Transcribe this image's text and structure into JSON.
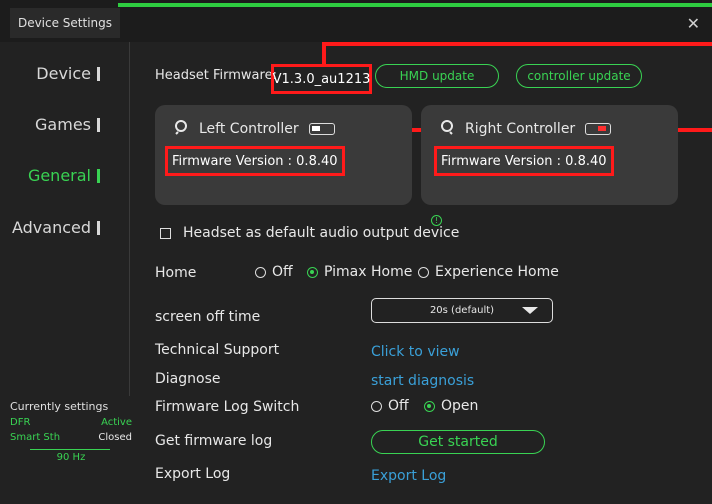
{
  "window": {
    "title": "Device Settings",
    "close_glyph": "✕"
  },
  "nav": {
    "items": [
      {
        "label": "Device",
        "active": false
      },
      {
        "label": "Games",
        "active": false
      },
      {
        "label": "General",
        "active": true
      },
      {
        "label": "Advanced",
        "active": false
      }
    ]
  },
  "current_settings": {
    "title": "Currently settings",
    "rows": [
      {
        "key": "DFR",
        "value": "Active"
      },
      {
        "key": "Smart Sth",
        "value": "Closed"
      }
    ],
    "refresh_rate": "90 Hz"
  },
  "headset": {
    "firmware_label": "Headset Firmware:",
    "firmware_value": "V1.3.0_au1213",
    "hmd_update_label": "HMD update",
    "controller_update_label": "controller update"
  },
  "controllers": {
    "left": {
      "name": "Left Controller",
      "firmware": "Firmware Version : 0.8.40"
    },
    "right": {
      "name": "Right Controller",
      "firmware": "Firmware Version : 0.8.40"
    }
  },
  "audio": {
    "label": "Headset as default audio output device",
    "checked": false
  },
  "home": {
    "label": "Home",
    "options": [
      "Off",
      "Pimax Home",
      "Experience Home"
    ],
    "selected": "Pimax Home"
  },
  "screen_off": {
    "label": "screen off time",
    "value": "20s (default)"
  },
  "technical_support": {
    "label": "Technical Support",
    "link": "Click to view"
  },
  "diagnose": {
    "label": "Diagnose",
    "link": "start diagnosis"
  },
  "firmware_log_switch": {
    "label": "Firmware Log Switch",
    "options": [
      "Off",
      "Open"
    ],
    "selected": "Open"
  },
  "firmware_log": {
    "label": "Get firmware log",
    "button": "Get started"
  },
  "export_log": {
    "label": "Export Log",
    "link": "Export Log"
  },
  "colors": {
    "accent_green": "#39d353",
    "highlight_red": "#ff1a1a",
    "link_blue": "#3aa0d8"
  }
}
